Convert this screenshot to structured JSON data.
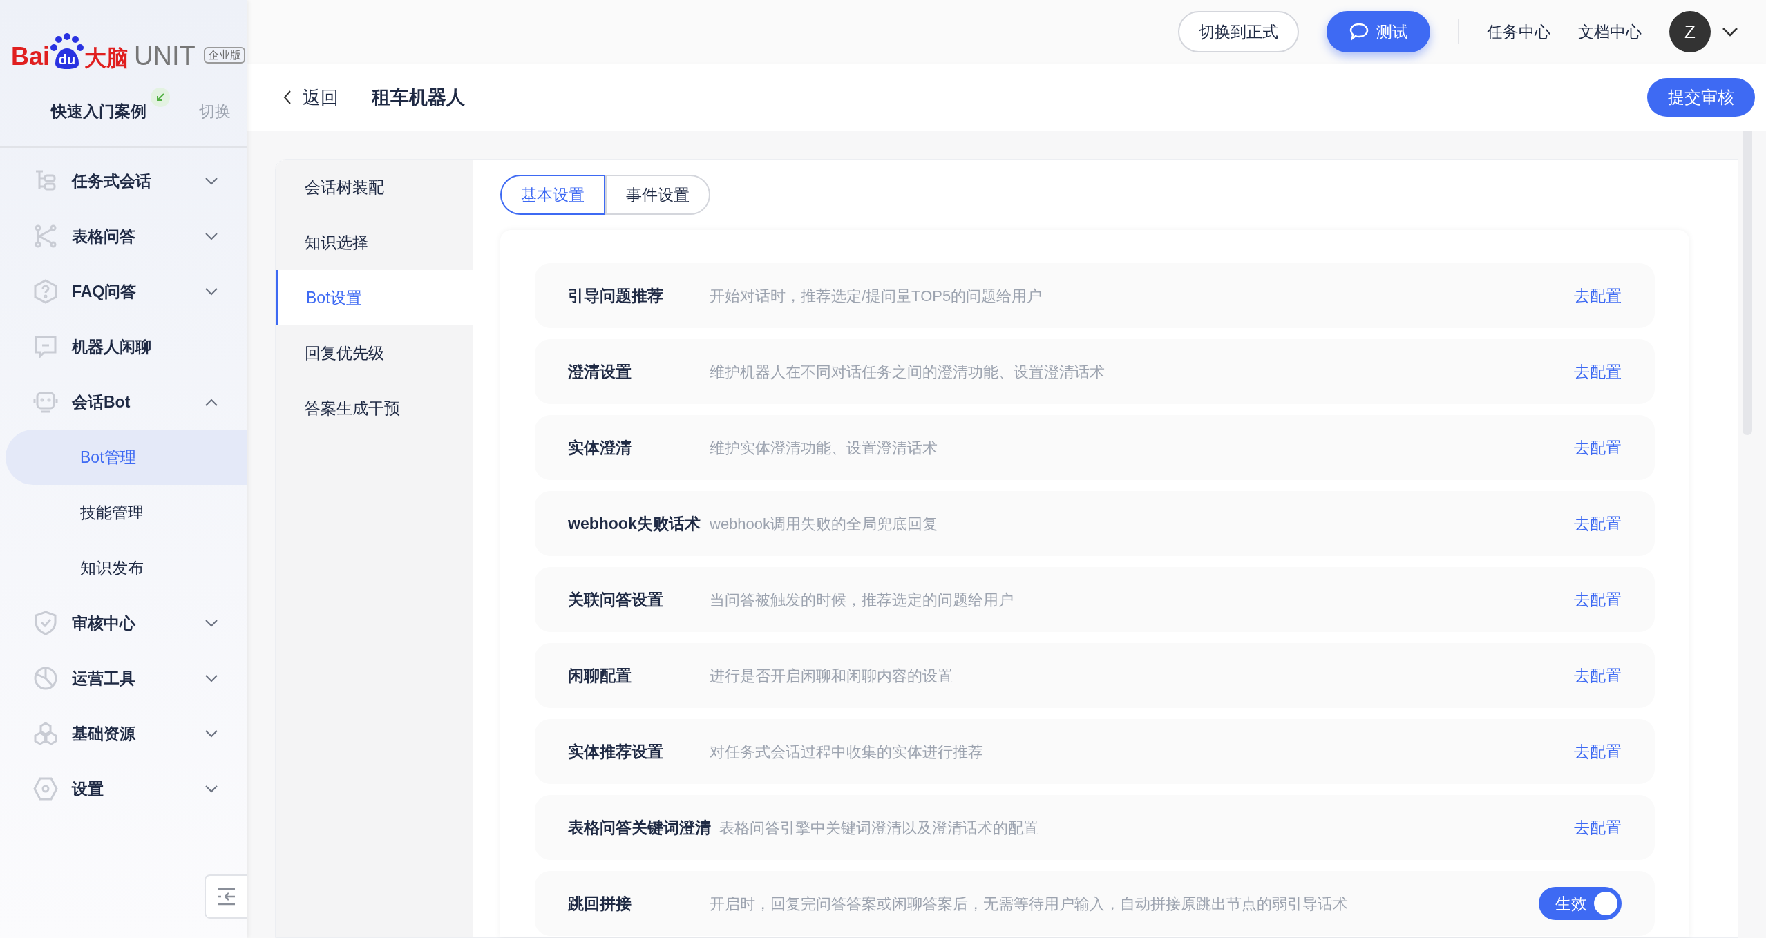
{
  "logo": {
    "brand": "Bai",
    "paw": "du",
    "product": "大脑",
    "name": "UNIT",
    "badge": "企业版"
  },
  "project": {
    "name": "快速入门案例",
    "switch": "切换"
  },
  "nav": [
    {
      "label": "任务式会话",
      "expanded": false
    },
    {
      "label": "表格问答",
      "expanded": false
    },
    {
      "label": "FAQ问答",
      "expanded": false
    },
    {
      "label": "机器人闲聊"
    },
    {
      "label": "会话Bot",
      "expanded": true,
      "children": [
        {
          "label": "Bot管理",
          "selected": true
        },
        {
          "label": "技能管理",
          "selected": false
        },
        {
          "label": "知识发布",
          "selected": false
        }
      ]
    },
    {
      "label": "审核中心",
      "expanded": false
    },
    {
      "label": "运营工具",
      "expanded": false
    },
    {
      "label": "基础资源",
      "expanded": false
    },
    {
      "label": "设置",
      "expanded": false
    }
  ],
  "topbar": {
    "switch_button": "切换到正式",
    "test_button": "测试",
    "links": [
      "任务中心",
      "文档中心"
    ],
    "avatar": "Z"
  },
  "header": {
    "back": "返回",
    "title": "租车机器人",
    "submit": "提交审核"
  },
  "subnav": [
    {
      "label": "会话树装配",
      "selected": false
    },
    {
      "label": "知识选择",
      "selected": false
    },
    {
      "label": "Bot设置",
      "selected": true
    },
    {
      "label": "回复优先级",
      "selected": false
    },
    {
      "label": "答案生成干预",
      "selected": false
    }
  ],
  "tabs": [
    {
      "label": "基本设置",
      "selected": true
    },
    {
      "label": "事件设置",
      "selected": false
    }
  ],
  "settings": [
    {
      "title": "引导问题推荐",
      "description": "开始对话时，推荐选定/提问量TOP5的问题给用户",
      "kind": "link",
      "action": "去配置"
    },
    {
      "title": "澄清设置",
      "description": "维护机器人在不同对话任务之间的澄清功能、设置澄清话术",
      "kind": "link",
      "action": "去配置"
    },
    {
      "title": "实体澄清",
      "description": "维护实体澄清功能、设置澄清话术",
      "kind": "link",
      "action": "去配置"
    },
    {
      "title": "webhook失败话术",
      "description": "webhook调用失败的全局兜底回复",
      "kind": "link",
      "action": "去配置"
    },
    {
      "title": "关联问答设置",
      "description": "当问答被触发的时候，推荐选定的问题给用户",
      "kind": "link",
      "action": "去配置"
    },
    {
      "title": "闲聊配置",
      "description": "进行是否开启闲聊和闲聊内容的设置",
      "kind": "link",
      "action": "去配置"
    },
    {
      "title": "实体推荐设置",
      "description": "对任务式会话过程中收集的实体进行推荐",
      "kind": "link",
      "action": "去配置"
    },
    {
      "title": "表格问答关键词澄清",
      "description": "表格问答引擎中关键词澄清以及澄清话术的配置",
      "kind": "link",
      "action": "去配置"
    },
    {
      "title": "跳回拼接",
      "description": "开启时，回复完问答答案或闲聊答案后，无需等待用户输入，自动拼接原跳出节点的弱引导话术",
      "kind": "switch",
      "action": "生效",
      "on": true
    }
  ]
}
